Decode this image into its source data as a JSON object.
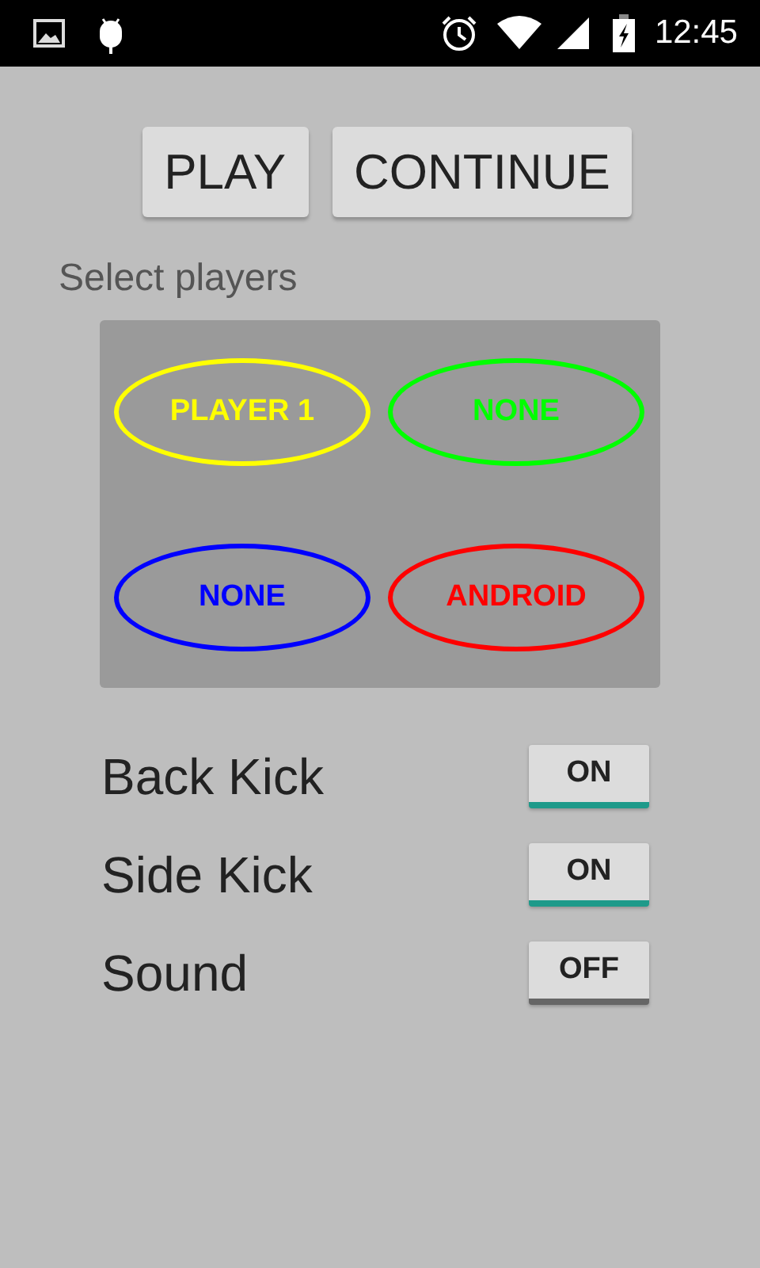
{
  "status_bar": {
    "time": "12:45"
  },
  "buttons": [
    "PLAY",
    "CONTINUE"
  ],
  "players_label": "Select players",
  "players": [
    {
      "label": "PLAYER 1",
      "color": "#ffff00"
    },
    {
      "label": "NONE",
      "color": "#00ff00"
    },
    {
      "label": "NONE",
      "color": "#0000ff"
    },
    {
      "label": "ANDROID",
      "color": "#ff0000"
    }
  ],
  "toggles": [
    {
      "label": "Back Kick",
      "text": "ON",
      "on": true
    },
    {
      "label": "Side Kick",
      "text": "ON",
      "on": true
    },
    {
      "label": "Sound",
      "text": "OFF",
      "on": false
    }
  ]
}
